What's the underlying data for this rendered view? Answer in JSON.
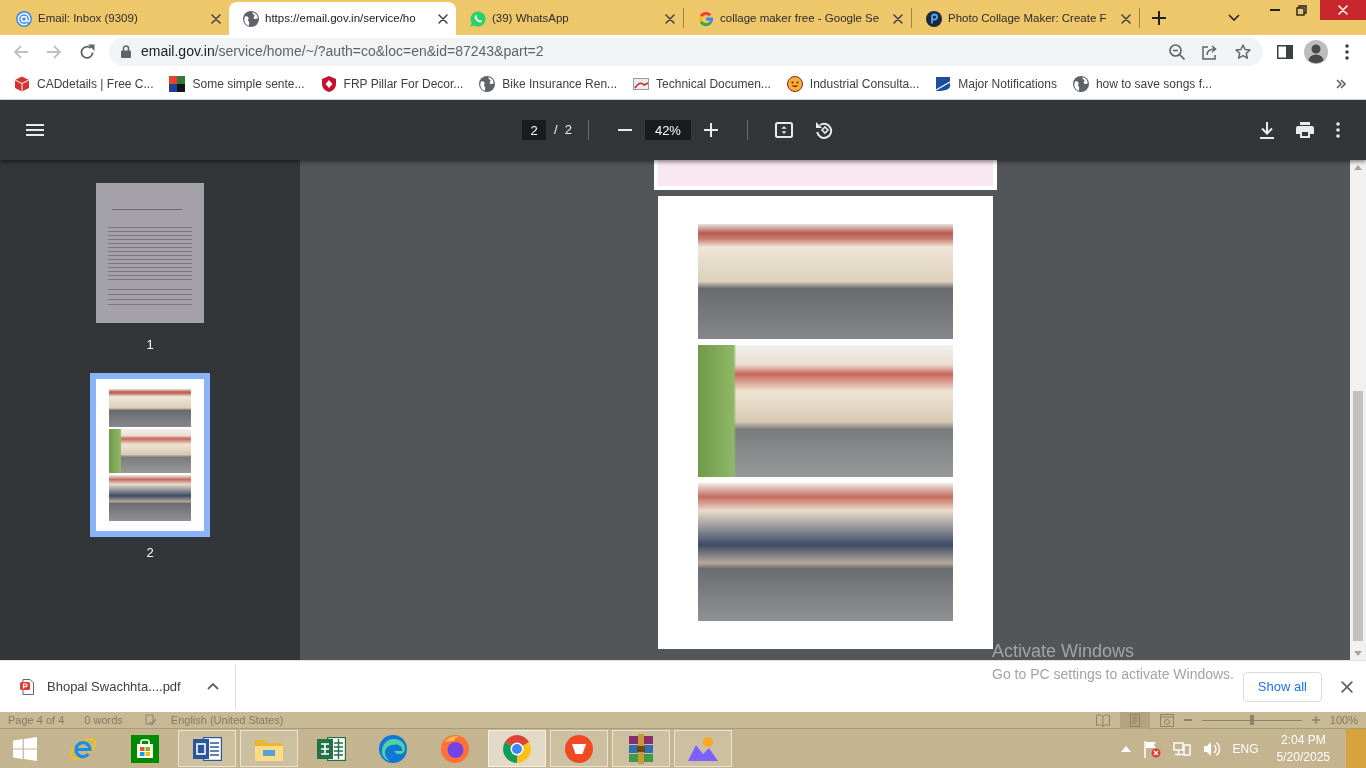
{
  "tabs": [
    {
      "title": "Email: Inbox (9309)",
      "selected": false
    },
    {
      "title": "https://email.gov.in/service/ho",
      "selected": true
    },
    {
      "title": "(39) WhatsApp",
      "selected": false
    },
    {
      "title": "collage maker free - Google Se",
      "selected": false
    },
    {
      "title": "Photo Collage Maker: Create F",
      "selected": false
    }
  ],
  "toolbar": {
    "back": {
      "disabled": true
    },
    "forward": {
      "disabled": true
    },
    "url": {
      "host": "email.gov.in",
      "path": "/service/home/~/?auth=co&loc=en&id=87243&part=2"
    }
  },
  "bookmarks": [
    "CADdetails | Free C...",
    "Some simple sente...",
    "FRP Pillar For Decor...",
    "Bike Insurance Ren...",
    "Technical Documen...",
    "Industrial Consulta...",
    "Major Notifications",
    "how to save songs f..."
  ],
  "pdf_viewer": {
    "page_number": "2",
    "page_separator": "/",
    "page_total": "2",
    "zoom": "42%",
    "thumbnails": [
      {
        "label": "1",
        "selected": false
      },
      {
        "label": "2",
        "selected": true
      }
    ]
  },
  "download_bar": {
    "file_name": "Bhopal Swachhta....pdf",
    "show_all": "Show all"
  },
  "word_status_bar": {
    "page": "Page 4 of 4",
    "words": "0 words",
    "language": "English (United States)",
    "view_modes": [
      {
        "selected": false
      },
      {
        "selected": true
      },
      {
        "selected": false
      }
    ],
    "zoom_slider": {
      "level": 0.5
    },
    "zoom": "100%"
  },
  "taskbar": {
    "apps": [
      {
        "running": false,
        "selected": false
      },
      {
        "running": false,
        "selected": false
      },
      {
        "running": true,
        "selected": false
      },
      {
        "running": true,
        "selected": false
      },
      {
        "running": false,
        "selected": false
      },
      {
        "running": false,
        "selected": false
      },
      {
        "running": false,
        "selected": false
      },
      {
        "running": true,
        "selected": true
      },
      {
        "running": true,
        "selected": false
      },
      {
        "running": true,
        "selected": false
      },
      {
        "running": true,
        "selected": false
      }
    ],
    "tray": {
      "language": "ENG",
      "time": "2:04 PM",
      "date": "5/20/2025"
    }
  },
  "activation_notice": {
    "title": "Activate Windows",
    "message": "Go to PC settings to activate Windows."
  }
}
